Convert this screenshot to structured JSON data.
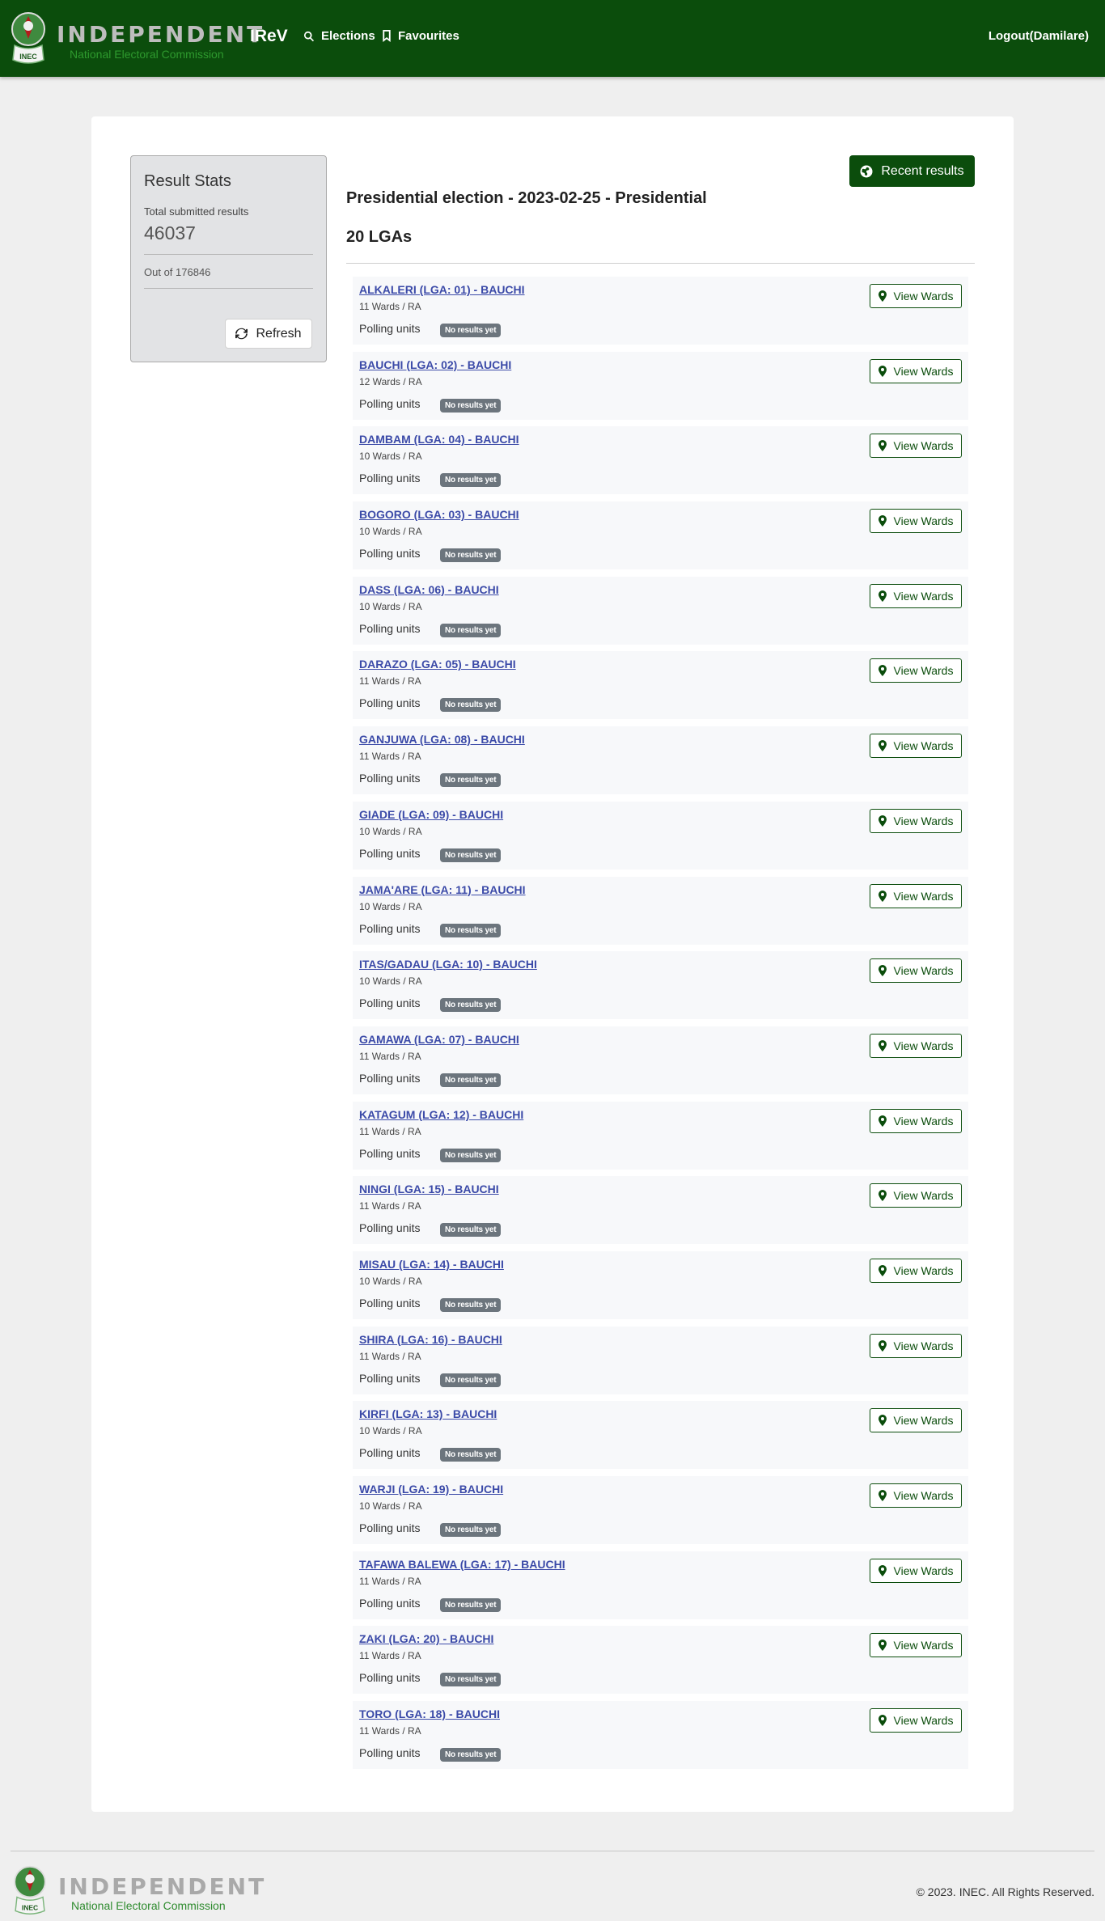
{
  "header": {
    "brand_word": "INDEPENDENT",
    "brand_sub": "National Electoral Commission",
    "emblem_label": "INEC",
    "app_title": "IReV",
    "nav": {
      "elections": "Elections",
      "favourites": "Favourites"
    },
    "logout": "Logout(Damilare)"
  },
  "stats": {
    "title": "Result Stats",
    "total_label": "Total submitted results",
    "total_value": "46037",
    "out_of": "Out of 176846",
    "refresh_label": "Refresh"
  },
  "main": {
    "recent_label": "Recent results",
    "election_title": "Presidential election - 2023-02-25 - Presidential",
    "lga_count": "20 LGAs",
    "polling_label": "Polling units",
    "badge_label": "No results yet",
    "view_wards_label": "View Wards",
    "lgas": [
      {
        "name": "ALKALERI (LGA: 01) - BAUCHI",
        "wards": "11 Wards / RA"
      },
      {
        "name": "BAUCHI (LGA: 02) - BAUCHI",
        "wards": "12 Wards / RA"
      },
      {
        "name": "DAMBAM (LGA: 04) - BAUCHI",
        "wards": "10 Wards / RA"
      },
      {
        "name": "BOGORO (LGA: 03) - BAUCHI",
        "wards": "10 Wards / RA"
      },
      {
        "name": "DASS (LGA: 06) - BAUCHI",
        "wards": "10 Wards / RA"
      },
      {
        "name": "DARAZO (LGA: 05) - BAUCHI",
        "wards": "11 Wards / RA"
      },
      {
        "name": "GANJUWA (LGA: 08) - BAUCHI",
        "wards": "11 Wards / RA"
      },
      {
        "name": "GIADE (LGA: 09) - BAUCHI",
        "wards": "10 Wards / RA"
      },
      {
        "name": "JAMA'ARE (LGA: 11) - BAUCHI",
        "wards": "10 Wards / RA"
      },
      {
        "name": "ITAS/GADAU (LGA: 10) - BAUCHI",
        "wards": "10 Wards / RA"
      },
      {
        "name": "GAMAWA (LGA: 07) - BAUCHI",
        "wards": "11 Wards / RA"
      },
      {
        "name": "KATAGUM (LGA: 12) - BAUCHI",
        "wards": "11 Wards / RA"
      },
      {
        "name": "NINGI (LGA: 15) - BAUCHI",
        "wards": "11 Wards / RA"
      },
      {
        "name": "MISAU (LGA: 14) - BAUCHI",
        "wards": "10 Wards / RA"
      },
      {
        "name": "SHIRA (LGA: 16) - BAUCHI",
        "wards": "11 Wards / RA"
      },
      {
        "name": "KIRFI (LGA: 13) - BAUCHI",
        "wards": "10 Wards / RA"
      },
      {
        "name": "WARJI (LGA: 19) - BAUCHI",
        "wards": "10 Wards / RA"
      },
      {
        "name": "TAFAWA BALEWA (LGA: 17) - BAUCHI",
        "wards": "11 Wards / RA"
      },
      {
        "name": "ZAKI (LGA: 20) - BAUCHI",
        "wards": "11 Wards / RA"
      },
      {
        "name": "TORO (LGA: 18) - BAUCHI",
        "wards": "11 Wards / RA"
      }
    ]
  },
  "footer": {
    "brand_word": "INDEPENDENT",
    "brand_sub": "National Electoral Commission",
    "emblem_label": "INEC",
    "copyright": "© 2023. INEC. All Rights Reserved."
  },
  "colors": {
    "brand_green": "#0b4d0c",
    "link_blue": "#3b4aa8",
    "badge_grey": "#6c757d"
  },
  "icons": {
    "nav_elections": "search-icon",
    "nav_favourites": "bookmark-icon",
    "refresh": "refresh-icon",
    "recent": "globe-icon",
    "view_wards": "map-marker-icon",
    "logo": "inec-emblem-icon"
  }
}
